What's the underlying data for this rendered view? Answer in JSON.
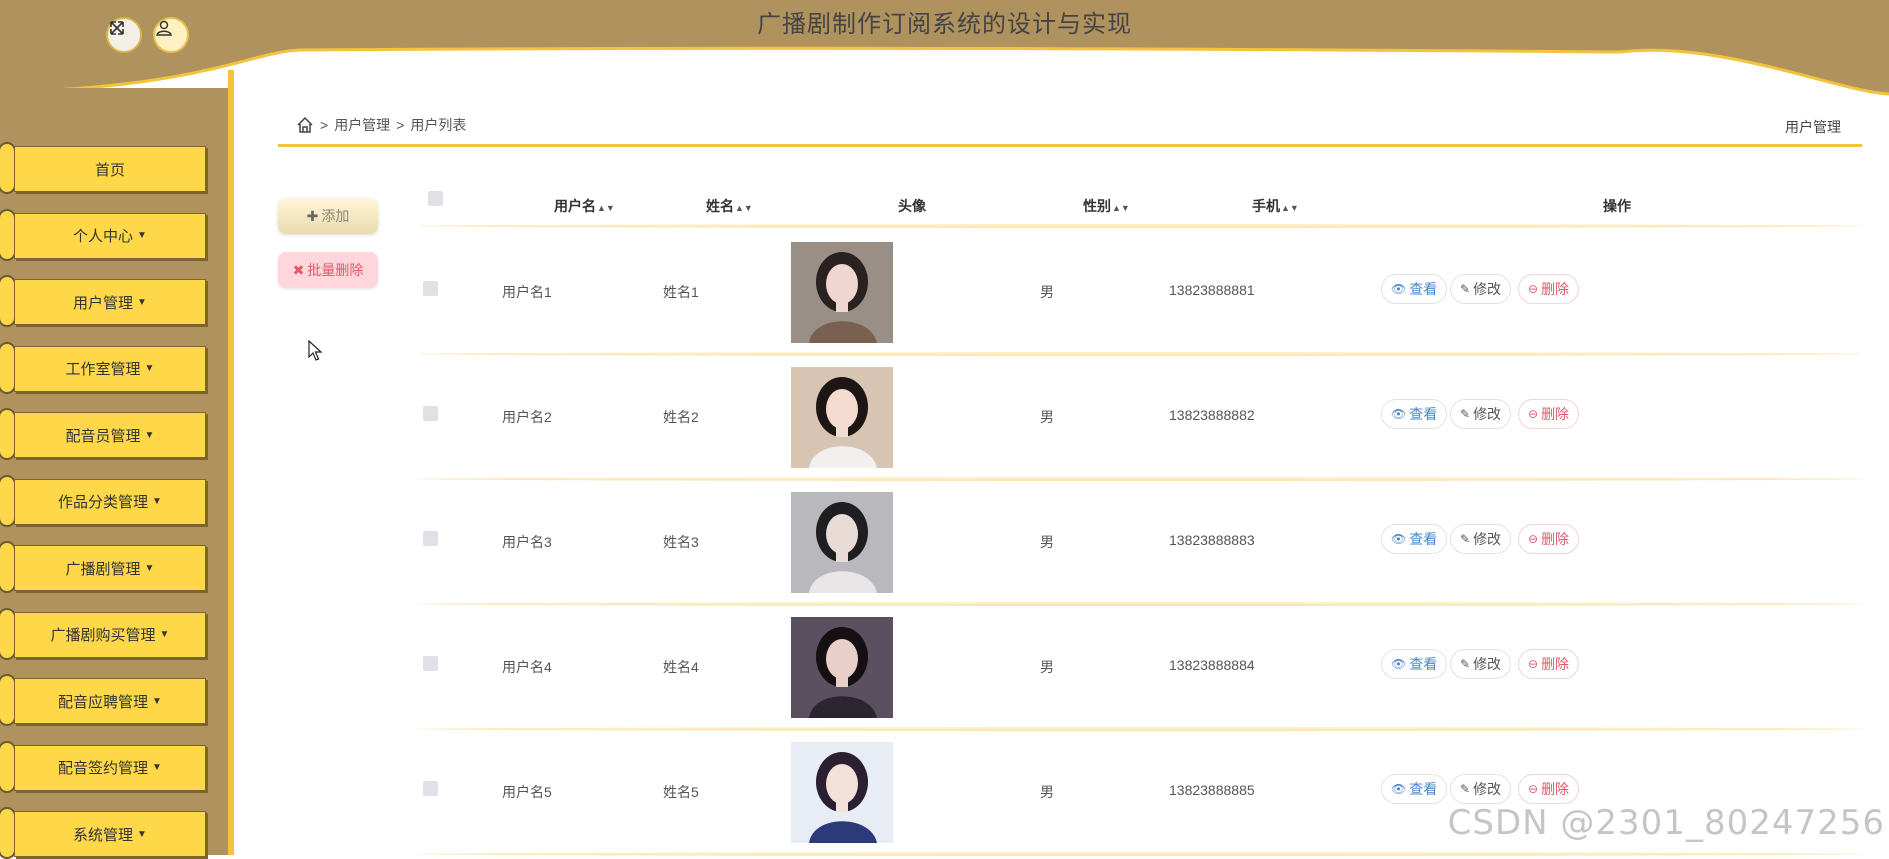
{
  "header": {
    "title": "广播剧制作订阅系统的设计与实现",
    "fullscreen_icon": "expand-icon",
    "user_icon": "user-icon"
  },
  "sidebar": {
    "items": [
      {
        "label": "首页",
        "caret": false
      },
      {
        "label": "个人中心",
        "caret": true
      },
      {
        "label": "用户管理",
        "caret": true
      },
      {
        "label": "工作室管理",
        "caret": true
      },
      {
        "label": "配音员管理",
        "caret": true
      },
      {
        "label": "作品分类管理",
        "caret": true
      },
      {
        "label": "广播剧管理",
        "caret": true
      },
      {
        "label": "广播剧购买管理",
        "caret": true
      },
      {
        "label": "配音应聘管理",
        "caret": true
      },
      {
        "label": "配音签约管理",
        "caret": true
      },
      {
        "label": "系统管理",
        "caret": true
      }
    ]
  },
  "breadcrumb": {
    "home_icon": "home-icon",
    "sep": ">",
    "level1": "用户管理",
    "level2": "用户列表",
    "right": "用户管理"
  },
  "actions": {
    "add": "添加",
    "batch_delete": "批量删除"
  },
  "table": {
    "headers": {
      "username": "用户名",
      "name": "姓名",
      "avatar": "头像",
      "gender": "性别",
      "phone": "手机",
      "ops": "操作"
    },
    "row_actions": {
      "view": "查看",
      "edit": "修改",
      "delete": "删除"
    },
    "rows": [
      {
        "username": "用户名1",
        "name": "姓名1",
        "gender": "男",
        "phone": "13823888881"
      },
      {
        "username": "用户名2",
        "name": "姓名2",
        "gender": "男",
        "phone": "13823888882"
      },
      {
        "username": "用户名3",
        "name": "姓名3",
        "gender": "男",
        "phone": "13823888883"
      },
      {
        "username": "用户名4",
        "name": "姓名4",
        "gender": "男",
        "phone": "13823888884"
      },
      {
        "username": "用户名5",
        "name": "姓名5",
        "gender": "男",
        "phone": "13823888885"
      }
    ]
  },
  "watermark": "CSDN @2301_80247256",
  "colors": {
    "header_bg": "#b0925e",
    "accent_yellow": "#f3c33d",
    "menu_bg": "#ffd84a"
  }
}
